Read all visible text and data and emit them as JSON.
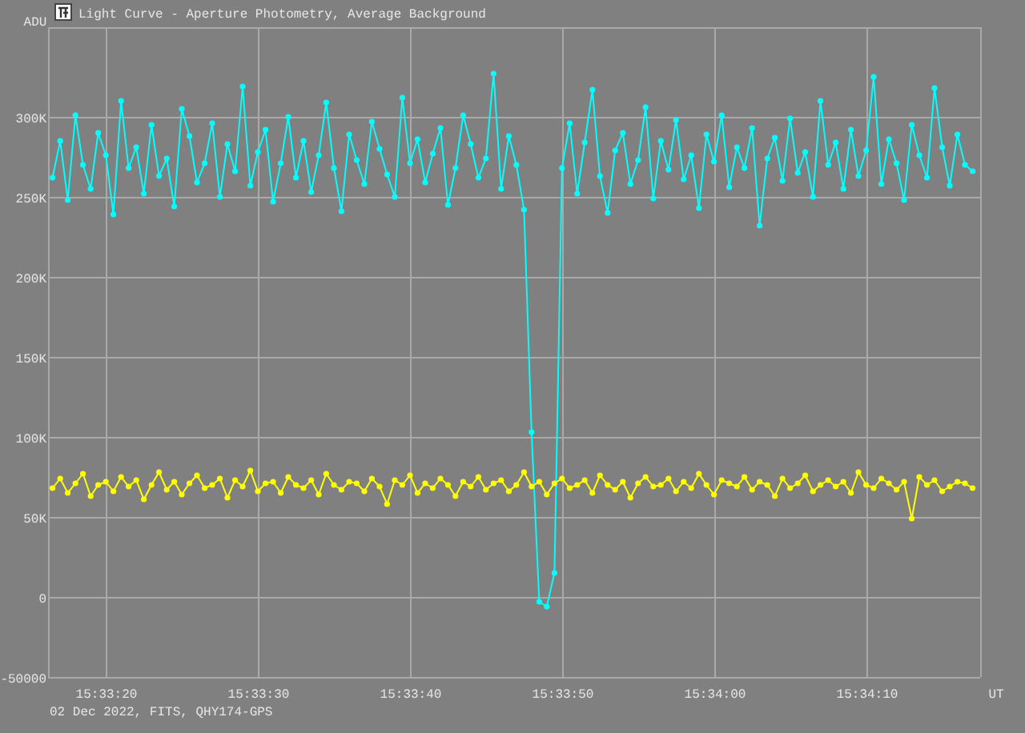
{
  "window": {
    "title": "Light Curve - Aperture Photometry, Average Background"
  },
  "chart": {
    "chart_data": {
      "type": "line",
      "ylabel": "ADU",
      "xlabel": "UT",
      "grid": true,
      "xlim": [
        55996.2,
        56057.5
      ],
      "ylim": [
        -50000,
        356000
      ],
      "xticks": [
        {
          "value": 56000,
          "label": "15:33:20"
        },
        {
          "value": 56010,
          "label": "15:33:30"
        },
        {
          "value": 56020,
          "label": "15:33:40"
        },
        {
          "value": 56030,
          "label": "15:33:50"
        },
        {
          "value": 56040,
          "label": "15:34:00"
        },
        {
          "value": 56050,
          "label": "15:34:10"
        }
      ],
      "yticks": [
        {
          "value": -50000,
          "label": "-50000"
        },
        {
          "value": 0,
          "label": "0"
        },
        {
          "value": 50000,
          "label": "50K"
        },
        {
          "value": 100000,
          "label": "100K"
        },
        {
          "value": 150000,
          "label": "150K"
        },
        {
          "value": 200000,
          "label": "200K"
        },
        {
          "value": 250000,
          "label": "250K"
        },
        {
          "value": 300000,
          "label": "300K"
        }
      ],
      "x": [
        55996.5,
        55997,
        55997.5,
        55998,
        55998.5,
        55999,
        55999.5,
        56000,
        56000.5,
        56001,
        56001.5,
        56002,
        56002.5,
        56003,
        56003.5,
        56004,
        56004.5,
        56005,
        56005.5,
        56006,
        56006.5,
        56007,
        56007.5,
        56008,
        56008.5,
        56009,
        56009.5,
        56010,
        56010.5,
        56011,
        56011.5,
        56012,
        56012.5,
        56013,
        56013.5,
        56014,
        56014.5,
        56015,
        56015.5,
        56016,
        56016.5,
        56017,
        56017.5,
        56018,
        56018.5,
        56019,
        56019.5,
        56020,
        56020.5,
        56021,
        56021.5,
        56022,
        56022.5,
        56023,
        56023.5,
        56024,
        56024.5,
        56025,
        56025.5,
        56026,
        56026.5,
        56027,
        56027.5,
        56028,
        56028.5,
        56029,
        56029.5,
        56030,
        56030.5,
        56031,
        56031.5,
        56032,
        56032.5,
        56033,
        56033.5,
        56034,
        56034.5,
        56035,
        56035.5,
        56036,
        56036.5,
        56037,
        56037.5,
        56038,
        56038.5,
        56039,
        56039.5,
        56040,
        56040.5,
        56041,
        56041.5,
        56042,
        56042.5,
        56043,
        56043.5,
        56044,
        56044.5,
        56045,
        56045.5,
        56046,
        56046.5,
        56047,
        56047.5,
        56048,
        56048.5,
        56049,
        56049.5,
        56050,
        56050.5,
        56051,
        56051.5,
        56052,
        56052.5,
        56053,
        56053.5,
        56054,
        56054.5,
        56055,
        56055.5,
        56056,
        56056.5,
        56057
      ],
      "series": [
        {
          "color": "#00ffff",
          "marker": "circle",
          "values": [
            262000,
            285000,
            248000,
            301000,
            270000,
            255000,
            290000,
            276000,
            239000,
            310000,
            268000,
            281000,
            252000,
            295000,
            263000,
            274000,
            244000,
            305000,
            288000,
            259000,
            271000,
            296000,
            250000,
            283000,
            266000,
            319000,
            257000,
            278000,
            292000,
            247000,
            271000,
            300000,
            262000,
            285000,
            253000,
            276000,
            309000,
            268000,
            241000,
            289000,
            273000,
            258000,
            297000,
            280000,
            264000,
            250000,
            312000,
            271000,
            286000,
            259000,
            277000,
            293000,
            245000,
            268000,
            301000,
            283000,
            262000,
            274000,
            327000,
            255000,
            288000,
            270000,
            242000,
            103000,
            -3000,
            -6000,
            15000,
            268000,
            296000,
            252000,
            284000,
            317000,
            263000,
            240000,
            279000,
            290000,
            258000,
            273000,
            306000,
            249000,
            285000,
            267000,
            298000,
            261000,
            276000,
            243000,
            289000,
            272000,
            301000,
            256000,
            281000,
            268000,
            293000,
            232000,
            274000,
            287000,
            260000,
            299000,
            265000,
            278000,
            250000,
            310000,
            270000,
            284000,
            255000,
            292000,
            263000,
            279000,
            325000,
            258000,
            286000,
            271000,
            248000,
            295000,
            276000,
            262000,
            318000,
            281000,
            257000,
            289000,
            270000,
            266000
          ]
        },
        {
          "color": "#ffff00",
          "marker": "circle",
          "values": [
            68000,
            74000,
            65000,
            71000,
            77000,
            63000,
            70000,
            72000,
            66000,
            75000,
            69000,
            73000,
            61000,
            70000,
            78000,
            67000,
            72000,
            64000,
            71000,
            76000,
            68000,
            70000,
            74000,
            62000,
            73000,
            69000,
            79000,
            66000,
            71000,
            72000,
            65000,
            75000,
            70000,
            68000,
            73000,
            64000,
            77000,
            70000,
            67000,
            72000,
            71000,
            66000,
            74000,
            69000,
            58000,
            73000,
            70000,
            76000,
            65000,
            71000,
            68000,
            74000,
            70000,
            63000,
            72000,
            69000,
            75000,
            67000,
            71000,
            73000,
            66000,
            70000,
            78000,
            69000,
            72000,
            64000,
            71000,
            74000,
            68000,
            70000,
            73000,
            65000,
            76000,
            70000,
            67000,
            72000,
            62000,
            71000,
            75000,
            69000,
            70000,
            74000,
            66000,
            72000,
            68000,
            77000,
            70000,
            64000,
            73000,
            71000,
            69000,
            75000,
            67000,
            72000,
            70000,
            63000,
            74000,
            68000,
            71000,
            76000,
            66000,
            70000,
            73000,
            69000,
            72000,
            65000,
            78000,
            70000,
            68000,
            74000,
            71000,
            67000,
            72000,
            49000,
            75000,
            70000,
            73000,
            66000,
            69000,
            72000,
            71000,
            68000
          ]
        }
      ]
    }
  },
  "footer": "02 Dec 2022, FITS, QHY174-GPS"
}
